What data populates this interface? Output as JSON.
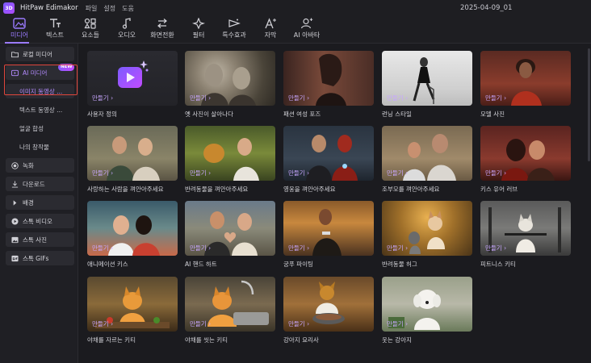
{
  "titlebar": {
    "app_name": "HitPaw Edimakor",
    "menu": [
      "파일",
      "설정",
      "도움"
    ],
    "project_name": "2025-04-09_01"
  },
  "toolbar": {
    "tools": [
      {
        "label": "미디어",
        "icon": "media-icon",
        "active": true
      },
      {
        "label": "텍스트",
        "icon": "text-icon",
        "active": false
      },
      {
        "label": "요소들",
        "icon": "elements-icon",
        "active": false
      },
      {
        "label": "오디오",
        "icon": "audio-icon",
        "active": false
      },
      {
        "label": "화면전환",
        "icon": "transition-icon",
        "active": false
      },
      {
        "label": "필터",
        "icon": "filter-icon",
        "active": false
      },
      {
        "label": "특수효과",
        "icon": "effects-icon",
        "active": false
      },
      {
        "label": "자막",
        "icon": "subtitle-icon",
        "active": false
      },
      {
        "label": "AI 아바타",
        "icon": "ai-avatar-icon",
        "active": false
      }
    ]
  },
  "sidebar": {
    "local_media": "로컬 미디어",
    "ai_media": "AI 미디어",
    "new_badge": "NEW",
    "sub_items": [
      "이미지 동영상 ...",
      "텍스트 동영상 ...",
      "얼굴 합성",
      "나의 창작물"
    ],
    "record": "녹화",
    "download": "다운로드",
    "background": "배경",
    "stock_video": "스톡 비디오",
    "stock_photo": "스톡 사진",
    "stock_gifs": "스톡 GIFs"
  },
  "content": {
    "make_label": "만들기 ›",
    "cards": [
      {
        "title": "사용자 정의"
      },
      {
        "title": "옛 사진이 살아나다"
      },
      {
        "title": "패션 여성 포즈"
      },
      {
        "title": "런닝 스타일"
      },
      {
        "title": "모델 사진"
      },
      {
        "title": "사랑하는 사람을 껴안아주세요"
      },
      {
        "title": "반려동물을 껴안아주세요"
      },
      {
        "title": "영웅을 껴안아주세요"
      },
      {
        "title": "조부모를 껴안아주세요"
      },
      {
        "title": "키스 유어 러브"
      },
      {
        "title": "애니메이션 키스"
      },
      {
        "title": "AI 핸드 하트"
      },
      {
        "title": "궁푸 파이팅"
      },
      {
        "title": "반려동물 허그"
      },
      {
        "title": "피트니스 키티"
      },
      {
        "title": "야채를 자르는 키티"
      },
      {
        "title": "야채를 씻는 키티"
      },
      {
        "title": "강아지 요리사"
      },
      {
        "title": "웃는 강아지"
      }
    ]
  }
}
